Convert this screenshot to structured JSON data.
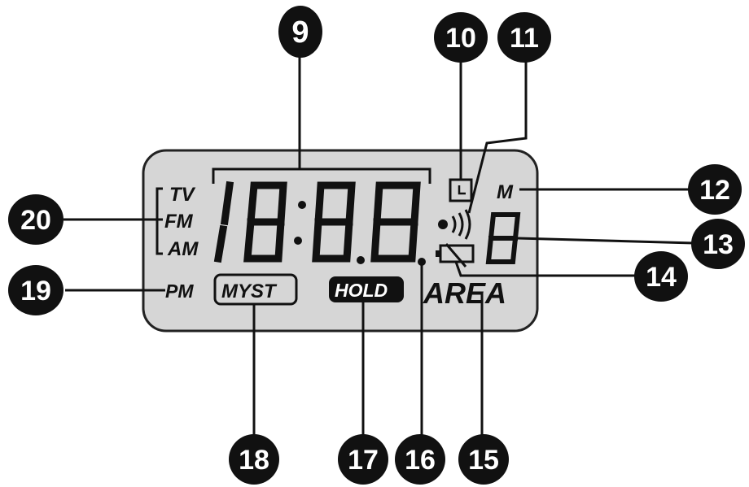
{
  "display": {
    "band_labels": [
      "TV",
      "FM",
      "AM"
    ],
    "pm_label": "PM",
    "mode_label": "M",
    "myst_label": "MYST",
    "hold_label": "HOLD",
    "area_label": "AREA",
    "clock_digits": "18:88",
    "small_digit": "8"
  },
  "callouts": [
    "9",
    "10",
    "11",
    "12",
    "13",
    "14",
    "15",
    "16",
    "17",
    "18",
    "19",
    "20"
  ],
  "colors": {
    "lcd_background": "#d6d6d6",
    "ink": "#111111",
    "callout_text": "#ffffff"
  }
}
